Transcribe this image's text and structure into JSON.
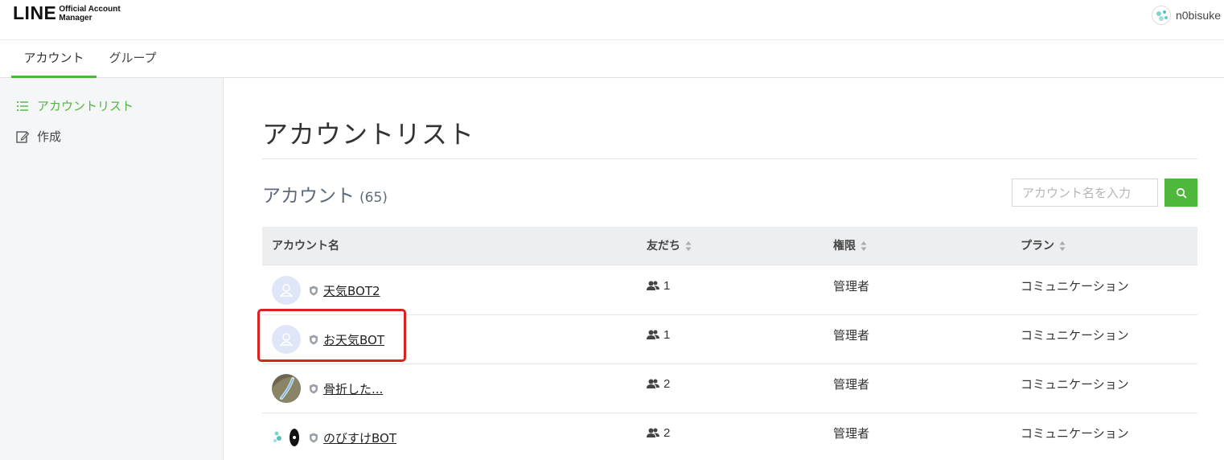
{
  "header": {
    "logo_main": "LINE",
    "logo_sub_1": "Official Account",
    "logo_sub_2": "Manager",
    "user_name": "n0bisuke"
  },
  "tabs": [
    {
      "label": "アカウント",
      "active": true
    },
    {
      "label": "グループ",
      "active": false
    }
  ],
  "sidebar": {
    "items": [
      {
        "label": "アカウントリスト",
        "icon": "list-icon",
        "active": true
      },
      {
        "label": "作成",
        "icon": "edit-icon",
        "active": false
      }
    ]
  },
  "main": {
    "title": "アカウントリスト",
    "section_title": "アカウント",
    "section_count": "(65)",
    "search_placeholder": "アカウント名を入力"
  },
  "table": {
    "columns": [
      "アカウント名",
      "友だち",
      "権限",
      "プラン"
    ],
    "rows": [
      {
        "name": "天気BOT2",
        "friends": "1",
        "role": "管理者",
        "plan": "コミュニケーション",
        "avatar": "default"
      },
      {
        "name": "お天気BOT",
        "friends": "1",
        "role": "管理者",
        "plan": "コミュニケーション",
        "avatar": "default"
      },
      {
        "name": "骨折した...",
        "friends": "2",
        "role": "管理者",
        "plan": "コミュニケーション",
        "avatar": "photo"
      },
      {
        "name": "のびすけBOT",
        "friends": "2",
        "role": "管理者",
        "plan": "コミュニケーション",
        "avatar": "logo"
      }
    ]
  },
  "colors": {
    "accent": "#4fb73b",
    "highlight": "#d8231f"
  }
}
